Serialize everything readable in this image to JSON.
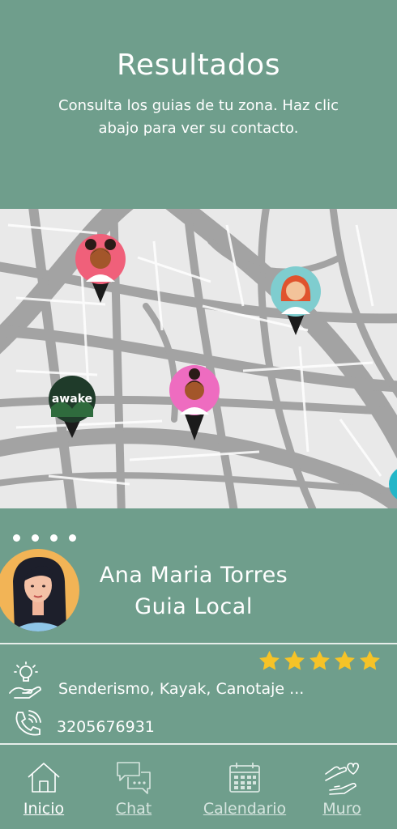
{
  "header": {
    "title": "Resultados",
    "subtitle": "Consulta los guias de tu zona. Haz clic abajo para ver su contacto."
  },
  "map": {
    "pins": [
      {
        "name": "guide-pin-1",
        "style": "woman-buns",
        "color": "#f0607a"
      },
      {
        "name": "guide-pin-2",
        "style": "woman-redhead",
        "color": "#7fcdcf"
      },
      {
        "name": "guide-pin-3",
        "style": "awake-logo",
        "color": "#1f3b2a",
        "logo_text": "awake"
      },
      {
        "name": "guide-pin-4",
        "style": "woman-bun",
        "color": "#ee6cc0"
      }
    ]
  },
  "guide": {
    "name": "Ana Maria Torres",
    "role": "Guia Local",
    "rating": 5,
    "skills": "Senderismo, Kayak, Canotaje ...",
    "phone": "3205676931"
  },
  "nav": {
    "items": [
      {
        "label": "Inicio",
        "icon": "home-icon",
        "active": true
      },
      {
        "label": "Chat",
        "icon": "chat-icon",
        "active": false
      },
      {
        "label": "Calendario",
        "icon": "calendar-icon",
        "active": false
      },
      {
        "label": "Muro",
        "icon": "wall-icon",
        "active": false
      }
    ]
  },
  "colors": {
    "background": "#6f9e8c",
    "star": "#f6c327",
    "map_land": "#e9e9e9",
    "map_roads": "#a3a3a3"
  }
}
